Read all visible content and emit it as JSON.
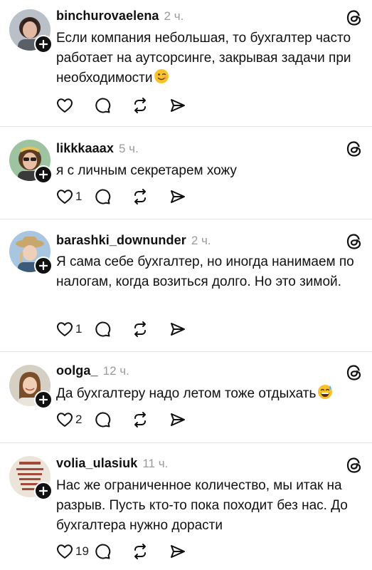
{
  "posts": [
    {
      "username": "binchurovaelena",
      "time": "2 ч.",
      "text": "Если компания небольшая, то бухгалтер часто работает на аутсорсинге, закрывая задачи при необходимости",
      "emoji": "winking-face",
      "likes": ""
    },
    {
      "username": "likkkaaax",
      "time": "5 ч.",
      "text": "я с личным секретарем хожу",
      "emoji": "",
      "likes": "1"
    },
    {
      "username": "barashki_downunder",
      "time": "2 ч.",
      "text": "Я сама себе бухгалтер, но иногда нанимаем по налогам, когда возиться долго. Но это зимой.",
      "emoji": "",
      "likes": "1"
    },
    {
      "username": "oolga_",
      "time": "12 ч.",
      "text": "Да бухгалтеру надо летом тоже отдыхать",
      "emoji": "grinning-sweat-face",
      "likes": "2"
    },
    {
      "username": "volia_ulasiuk",
      "time": "11 ч.",
      "text": "Нас же ограниченное  количество, мы  итак на разрыв. Пусть кто-то пока походит без нас. До бухгалтера нужно дорасти",
      "emoji": "",
      "likes": "19"
    }
  ],
  "icons": {
    "like": "heart-icon",
    "reply": "comment-bubble-icon",
    "repost": "repost-arrows-icon",
    "share": "paper-plane-icon",
    "logo": "threads-logo-icon",
    "follow": "plus-icon"
  },
  "colors": {
    "text": "#111111",
    "muted": "#9a9a9a",
    "divider": "#e5e5e5",
    "badge": "#111111"
  }
}
